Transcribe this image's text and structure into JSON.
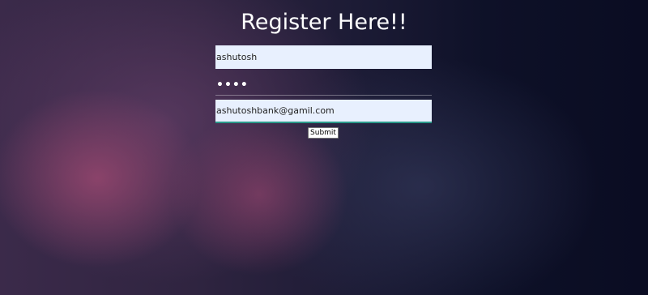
{
  "form": {
    "title": "Register Here!!",
    "username_value": "ashutosh",
    "password_value": "••••",
    "email_value": "ashutoshbank@gamil.com",
    "submit_label": "Submit"
  }
}
